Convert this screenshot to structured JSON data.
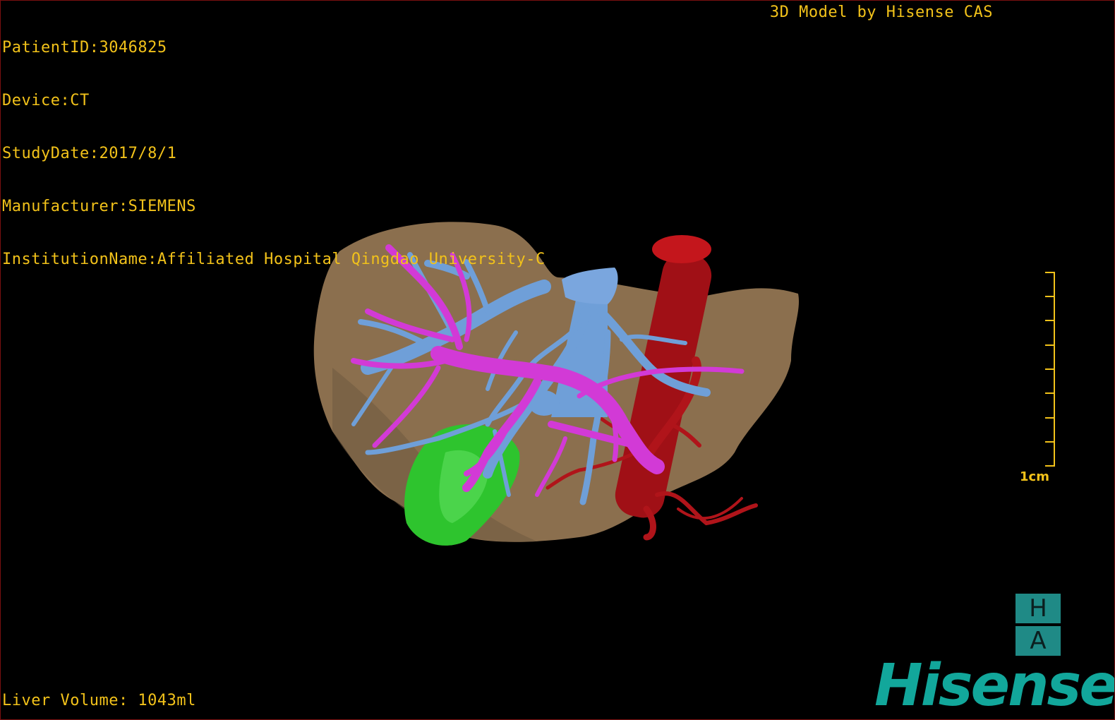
{
  "header": {
    "patient_id": "PatientID:3046825",
    "device": "Device:CT",
    "study_date": "StudyDate:2017/8/1",
    "manufacturer": "Manufacturer:SIEMENS",
    "institution": "InstitutionName:Affiliated Hospital Qingdao University-C"
  },
  "brand_top": "3D Model by Hisense CAS",
  "footer": {
    "liver_volume": "Liver Volume: 1043ml"
  },
  "scale_bar": {
    "label": "1cm"
  },
  "logo": {
    "ha_top": "H",
    "ha_bottom": "A",
    "brand": "Hisense"
  },
  "colors": {
    "liver": "#8b6f4e",
    "portal_vein": "#d23ad6",
    "hepatic_vein": "#6f9fd8",
    "artery": "#b0141a",
    "gallbladder": "#2ec42e",
    "overlay_text": "#f2c21a",
    "brand": "#12a79b"
  }
}
